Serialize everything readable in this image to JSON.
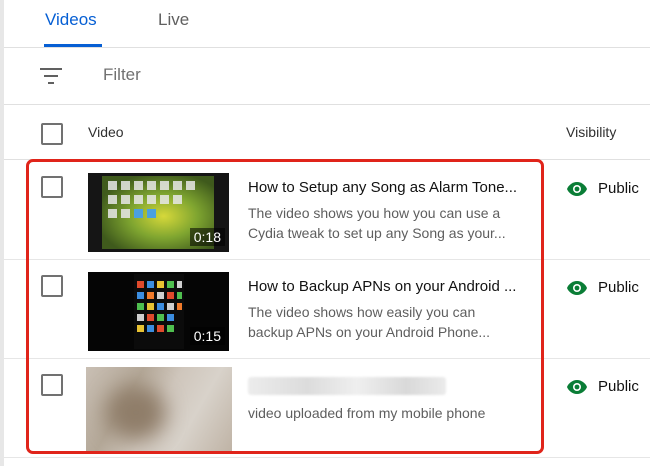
{
  "tabs": [
    {
      "label": "Videos",
      "active": true
    },
    {
      "label": "Live",
      "active": false
    }
  ],
  "filter": {
    "placeholder": "Filter",
    "icon": "filter-list-icon"
  },
  "table": {
    "columns": {
      "video": "Video",
      "visibility": "Visibility"
    },
    "rows": [
      {
        "title": "How to Setup any Song as Alarm Tone...",
        "description": "The video shows you how you can use a Cydia tweak to set up any Song as your...",
        "duration": "0:18",
        "visibility": "Public"
      },
      {
        "title": "How to Backup APNs on your Android ...",
        "description": "The video shows how easily you can backup APNs on your Android Phone...",
        "duration": "0:15",
        "visibility": "Public"
      },
      {
        "title": "",
        "description": "video uploaded from my mobile phone",
        "duration": "",
        "visibility": "Public"
      }
    ]
  },
  "colors": {
    "accent": "#065fd4",
    "public_eye": "#0a7d36",
    "highlight_border": "#e0241a"
  }
}
